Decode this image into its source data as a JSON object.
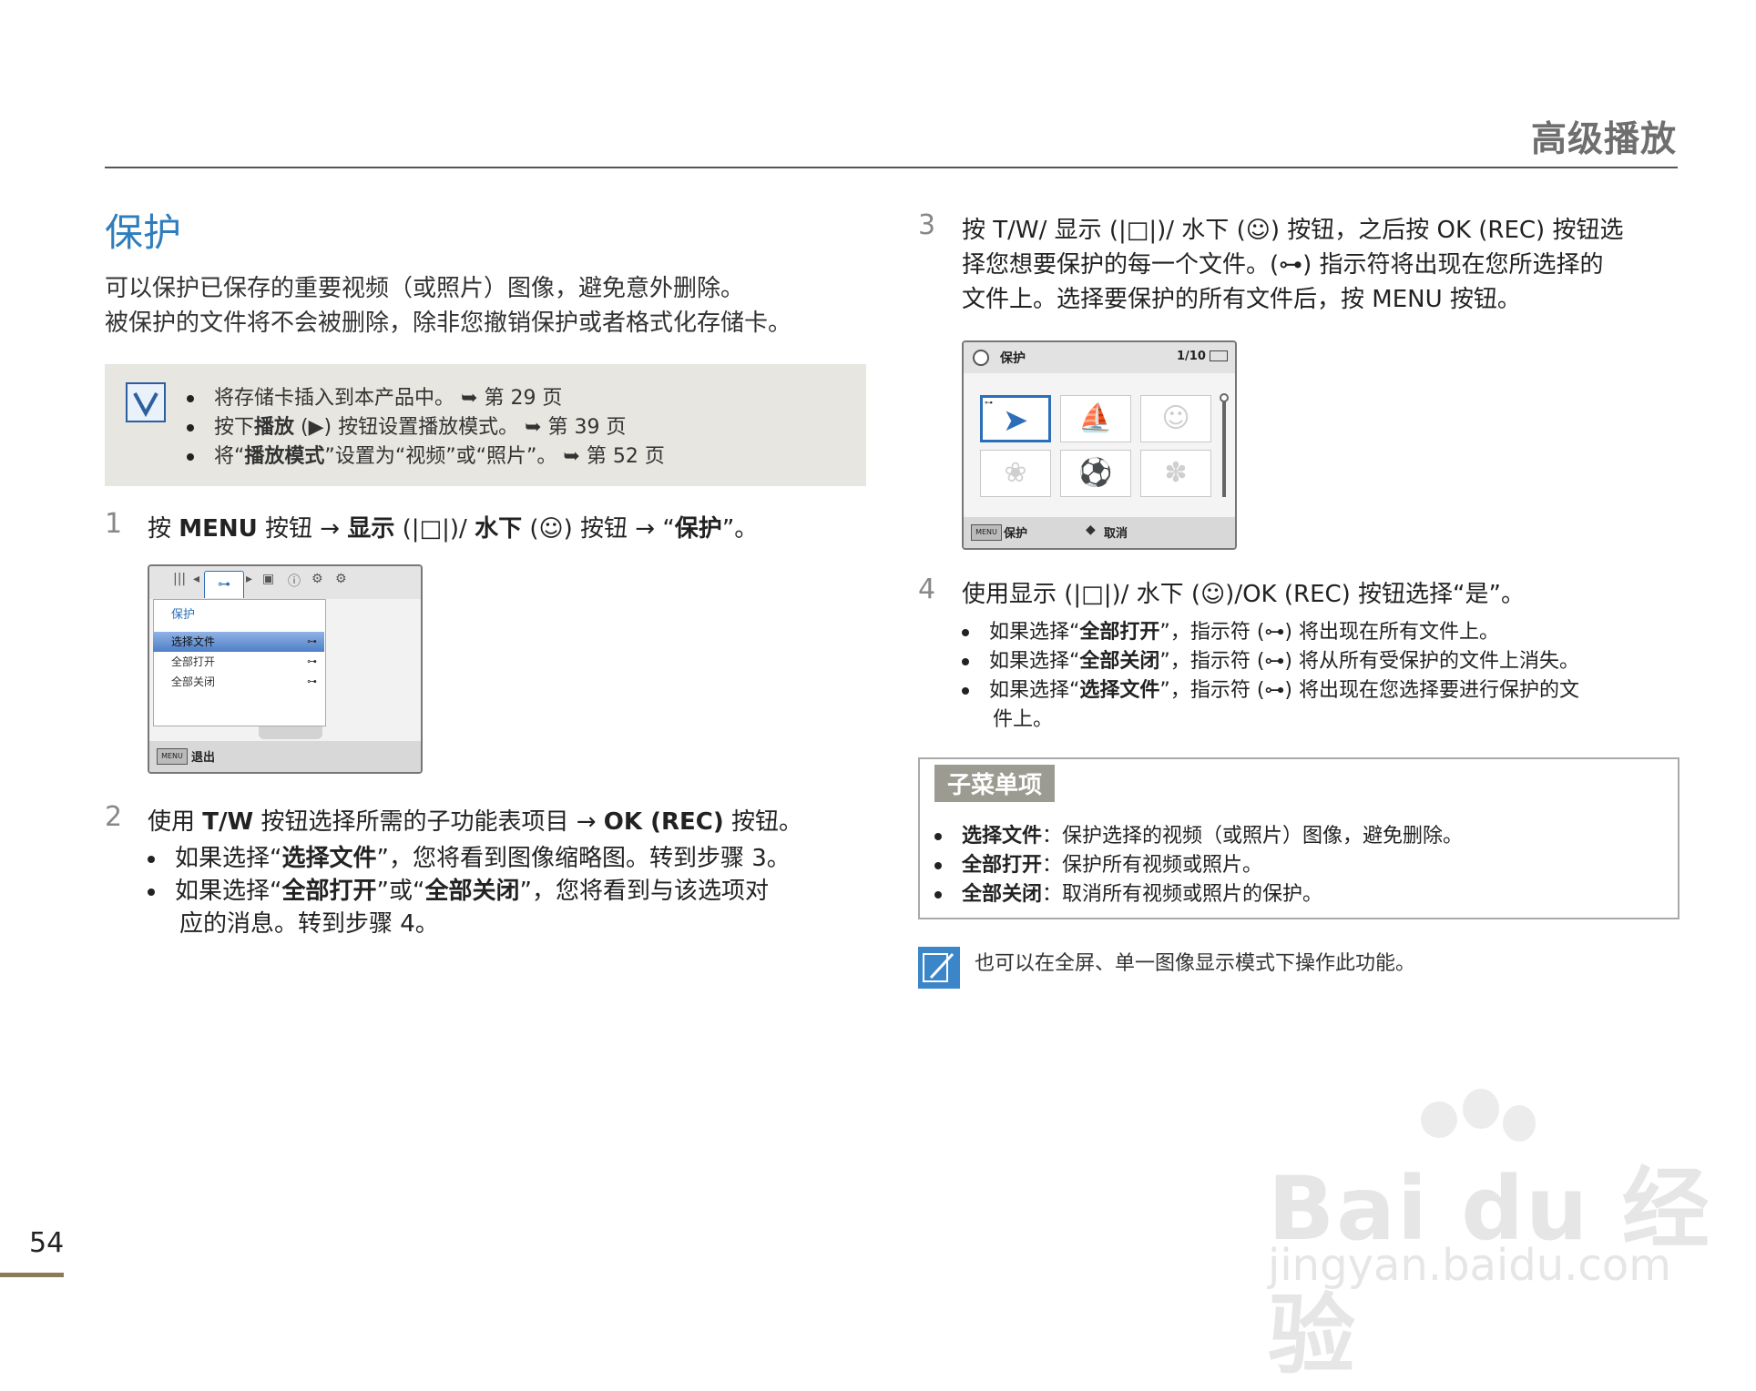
{
  "header": {
    "title": "高级播放"
  },
  "section": {
    "title": "保护",
    "intro": [
      "可以保护已保存的重要视频（或照片）图像，避免意外删除。",
      "被保护的文件将不会被删除，除非您撤销保护或者格式化存储卡。"
    ]
  },
  "prerequisites": {
    "items": [
      {
        "before": "将存储卡插入到本产品中。",
        "bold": "",
        "after": "",
        "ref_arrow": "➥",
        "ref": "第 29 页"
      },
      {
        "before": "按下",
        "bold": "播放",
        "after": " (▶) 按钮设置播放模式。",
        "ref_arrow": "➥",
        "ref": "第 39 页"
      },
      {
        "before": "将“",
        "bold": "播放模式",
        "after": "”设置为“视频”或“照片”。",
        "ref_arrow": "➥",
        "ref": "第 52 页"
      }
    ]
  },
  "step1": {
    "num": "1",
    "p1": "按 ",
    "b1": "MENU",
    "p2": " 按钮 → ",
    "b2": "显示",
    "p3": " (|□|)/ ",
    "b3": "水下",
    "p4": " (☺) 按钮 → “",
    "b4": "保护",
    "p5": "”。"
  },
  "screen1": {
    "tabs": [
      "|||",
      "◂",
      "⊶",
      "▸",
      "▣",
      "ⓘ",
      "⚙",
      "⚙"
    ],
    "menu_title": "保护",
    "items": [
      {
        "label": "选择文件",
        "icon": "⊶"
      },
      {
        "label": "全部打开",
        "icon": "⊶"
      },
      {
        "label": "全部关闭",
        "icon": "⊶"
      }
    ],
    "menu_button": "MENU",
    "exit_label": "退出"
  },
  "step2": {
    "num": "2",
    "p1": "使用 ",
    "b1": "T/W",
    "p2": " 按钮选择所需的子功能表项目 → ",
    "b2": "OK (REC)",
    "p3": " 按钮。",
    "bullets": [
      {
        "p1": "如果选择“",
        "b1": "选择文件",
        "p2": "”，您将看到图像缩略图。转到步骤  3。",
        "p3": ""
      },
      {
        "p1": "如果选择“",
        "b1": "全部打开",
        "p2": "”或“",
        "b2": "全部关闭",
        "p3": "”，您将看到与该选项对",
        "cont": "应的消息。转到步骤  4。"
      }
    ]
  },
  "step3": {
    "num": "3",
    "line1": "按 T/W/ 显示 (|□|)/ 水下 (☺) 按钮，之后按 OK (REC) 按钮选",
    "line2": "择您想要保护的每一个文件。(⊶) 指示符将出现在您所选择的",
    "line3": "文件上。选择要保护的所有文件后，按 MENU 按钮。"
  },
  "screen2": {
    "title": "保护",
    "count": "1/10",
    "thumbs": [
      "➤",
      "⛵",
      "☺",
      "❀",
      "⚽",
      "✽"
    ],
    "menu_button": "MENU",
    "protect_label": "保护",
    "nav_icon": "◆",
    "cancel_label": "取消"
  },
  "step4": {
    "num": "4",
    "line": "使用显示 (|□|)/ 水下 (☺)/OK (REC) 按钮选择“是”。",
    "bullets": [
      {
        "p1": "如果选择“",
        "b1": "全部打开",
        "p2": "”，指示符 (⊶) 将出现在所有文件上。"
      },
      {
        "p1": "如果选择“",
        "b1": "全部关闭",
        "p2": "”，指示符 (⊶) 将从所有受保护的文件上消失。"
      },
      {
        "p1": "如果选择“",
        "b1": "选择文件",
        "p2": "”，指示符 (⊶) 将出现在您选择要进行保护的文",
        "cont": "件上。"
      }
    ]
  },
  "submenu": {
    "label": "子菜单项",
    "items": [
      {
        "term": "选择文件",
        "desc": "：保护选择的视频（或照片）图像，避免删除。"
      },
      {
        "term": "全部打开",
        "desc": "：保护所有视频或照片。"
      },
      {
        "term": "全部关闭",
        "desc": "：取消所有视频或照片的保护。"
      }
    ]
  },
  "note": {
    "text": "也可以在全屏、单一图像显示模式下操作此功能。"
  },
  "footer": {
    "page_number": "54"
  },
  "watermark": {
    "line1": "Bai du 经验",
    "line2": "jingyan.baidu.com"
  }
}
